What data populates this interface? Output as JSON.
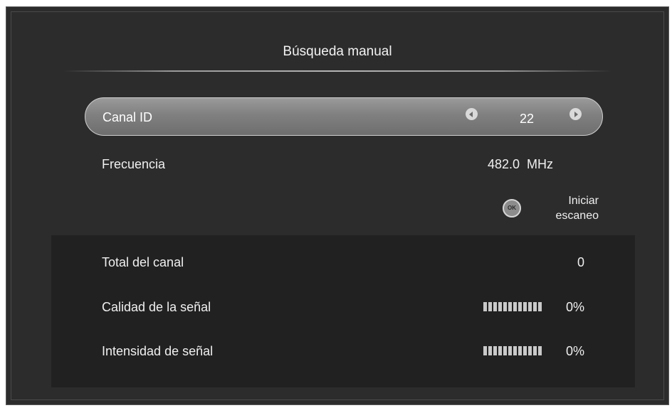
{
  "dialog": {
    "title": "Búsqueda manual"
  },
  "canal": {
    "label": "Canal ID",
    "value": "22",
    "left_icon": "arrow-left-icon",
    "right_icon": "arrow-right-icon"
  },
  "frecuencia": {
    "label": "Frecuencia",
    "value": "482.0  MHz"
  },
  "scan": {
    "icon": "ok-button-icon",
    "icon_text": "OK",
    "label_line1": "Iniciar",
    "label_line2": "escaneo"
  },
  "stats": {
    "total": {
      "label": "Total del canal",
      "value": "0"
    },
    "quality": {
      "label": "Calidad de la señal",
      "value": "0%",
      "level": 0
    },
    "strength": {
      "label": "Intensidad de señal",
      "value": "0%",
      "level": 0
    }
  },
  "colors": {
    "background": "#2c2c2c",
    "panel": "#212121",
    "highlight": "#8a8a8a",
    "text": "#f0f0f0"
  }
}
